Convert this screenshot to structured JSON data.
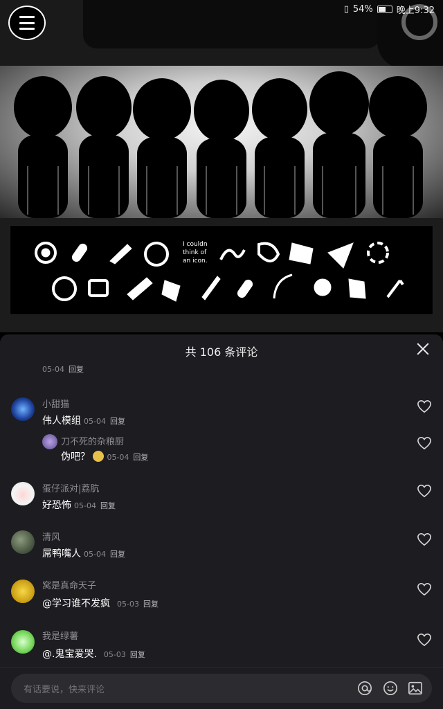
{
  "status": {
    "battery": "54%",
    "time": "晚上9:32",
    "battery_fraction": 0.54
  },
  "hero": {
    "panel_text": [
      "I couldn",
      "think of",
      "an icon."
    ]
  },
  "sheet": {
    "title": "共 106 条评论",
    "prev_meta": {
      "date": "05-04",
      "reply": "回复"
    },
    "comments": [
      {
        "user": "小甜猫",
        "text": "伟人模组",
        "date": "05-04",
        "reply": "回复"
      },
      {
        "user": "刀不死的杂粮厨",
        "text": "伪吧？",
        "date": "05-04",
        "reply": "回复",
        "is_reply": true
      },
      {
        "user": "蛋仔派对|荔肮",
        "text": "好恐怖",
        "date": "05-04",
        "reply": "回复"
      },
      {
        "user": "清风",
        "text": "屌鸭嘴人",
        "date": "05-04",
        "reply": "回复"
      },
      {
        "user": "窝是真命天子",
        "text": "@学习谁不发疯",
        "date": "05-03",
        "reply": "回复"
      },
      {
        "user": "我是绿薯",
        "text": "@.鬼宝爱哭.",
        "date": "05-03",
        "reply": "回复"
      }
    ],
    "input_placeholder": "有话要说，快来评论"
  }
}
